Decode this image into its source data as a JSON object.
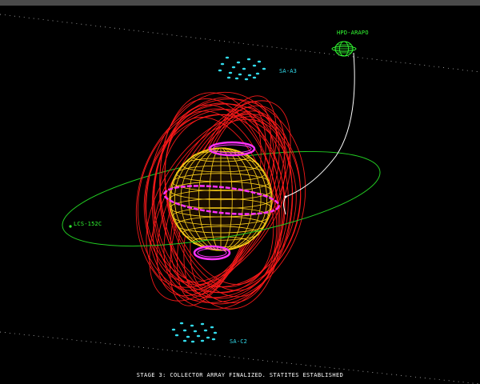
{
  "window": {
    "title_bar": ""
  },
  "labels": {
    "station": "HPD-ARAPO",
    "array_top": "SA-A3",
    "array_bottom": "SA-C2",
    "orbital_marker": "LCS-152C"
  },
  "status_text": "STAGE 3: COLLECTOR ARRAY FINALIZED. STATITES ESTABLISHED",
  "colors": {
    "background": "#000000",
    "star_grid": "#ffd21a",
    "coronal_loops": "#ff1a1a",
    "magnetic_rings": "#ff33ff",
    "orbit": "#22cc22",
    "station": "#33ff33",
    "array_markers": "#33ddee",
    "tether": "#ffffff",
    "status_text": "#ffffff"
  },
  "icons": {
    "star": "wireframe-sphere",
    "station": "wireframe-globe",
    "array_element": "cyan-satellite-dot"
  }
}
